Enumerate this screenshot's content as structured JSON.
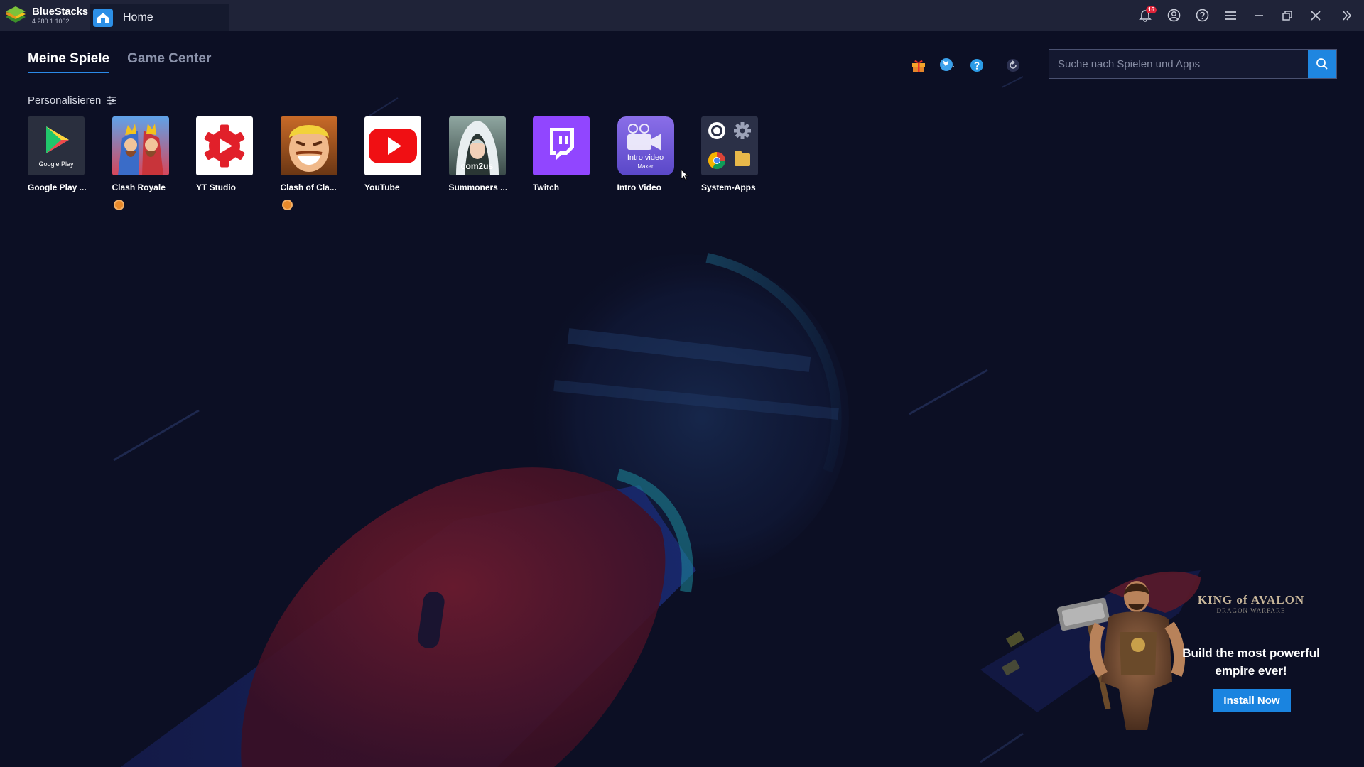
{
  "app": {
    "brand_name": "BlueStacks",
    "version": "4.280.1.1002",
    "home_tab": "Home",
    "notification_count": "16"
  },
  "nav": {
    "tabs": [
      {
        "label": "Meine Spiele",
        "active": true
      },
      {
        "label": "Game Center",
        "active": false
      }
    ]
  },
  "search": {
    "placeholder": "Suche nach Spielen und Apps"
  },
  "personalize": {
    "label": "Personalisieren"
  },
  "apps": [
    {
      "label": "Google Play ...",
      "icon": "google-play-icon",
      "icon_caption": "Google Play",
      "badge": false
    },
    {
      "label": "Clash Royale",
      "icon": "clash-royale-icon",
      "badge": true
    },
    {
      "label": "YT Studio",
      "icon": "yt-studio-icon",
      "badge": false
    },
    {
      "label": "Clash of Cla...",
      "icon": "clash-of-clans-icon",
      "badge": true
    },
    {
      "label": "YouTube",
      "icon": "youtube-icon",
      "badge": false
    },
    {
      "label": "Summoners ...",
      "icon": "summoners-war-icon",
      "icon_caption": "com2us",
      "badge": false
    },
    {
      "label": "Twitch",
      "icon": "twitch-icon",
      "badge": false
    },
    {
      "label": "Intro Video",
      "icon": "intro-video-maker-icon",
      "icon_caption_1": "Intro video",
      "icon_caption_2": "Maker",
      "badge": false
    },
    {
      "label": "System-Apps",
      "icon": "system-apps-icon",
      "badge": false
    }
  ],
  "promo": {
    "logo_title": "KING of AVALON",
    "logo_subtitle": "DRAGON WARFARE",
    "headline": "Build the most powerful empire ever!",
    "button": "Install Now"
  },
  "colors": {
    "accent": "#1f86e0",
    "background": "#0c0f24",
    "titlebar": "#1f2338",
    "badge": "#e0243a"
  }
}
